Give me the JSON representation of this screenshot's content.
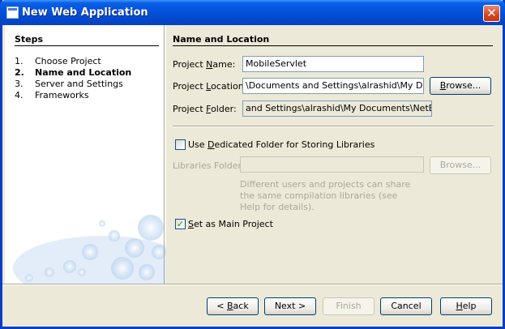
{
  "window": {
    "title": "New Web Application",
    "close_glyph": "✕"
  },
  "steps": {
    "heading": "Steps",
    "items": [
      {
        "num": "1.",
        "label": "Choose Project"
      },
      {
        "num": "2.",
        "label": "Name and Location"
      },
      {
        "num": "3.",
        "label": "Server and Settings"
      },
      {
        "num": "4.",
        "label": "Frameworks"
      }
    ],
    "active_index": 1
  },
  "panel": {
    "title": "Name and Location",
    "project_name": {
      "label_pre": "Project ",
      "label_key": "N",
      "label_post": "ame:",
      "value": "MobileServlet"
    },
    "project_location": {
      "label_pre": "Project ",
      "label_key": "L",
      "label_post": "ocation:",
      "value": "\\Documents and Settings\\alrashid\\My Documents"
    },
    "project_folder": {
      "label_pre": "Project ",
      "label_key": "F",
      "label_post": "older:",
      "value": "and Settings\\alrashid\\My Documents\\NetBeansProjects\\MobileServlet"
    },
    "browse_label": {
      "pre": "",
      "key": "B",
      "post": "rowse..."
    },
    "dedicated_folder": {
      "checked": false,
      "pre": "Use ",
      "key": "D",
      "post": "edicated Folder for Storing Libraries"
    },
    "libraries_folder": {
      "label": "Libraries Folder:",
      "value": ""
    },
    "browse_disabled_label": "Browse...",
    "help_text": "Different users and projects can share the same compilation libraries (see Help for details).",
    "main_project": {
      "checked": true,
      "pre": "",
      "key": "S",
      "post": "et as Main Project"
    }
  },
  "buttons": {
    "back": {
      "pre": "< ",
      "key": "B",
      "post": "ack"
    },
    "next": "Next >",
    "finish": "Finish",
    "cancel": "Cancel",
    "help": {
      "pre": "",
      "key": "H",
      "post": "elp"
    }
  },
  "icons": {
    "app": "window-icon",
    "close": "close-icon",
    "check": "checkmark-icon"
  },
  "colors": {
    "titlebar": "#0450d9",
    "dialog_bg": "#ece9d8",
    "close_button": "#d5461f",
    "check": "#21a121"
  }
}
